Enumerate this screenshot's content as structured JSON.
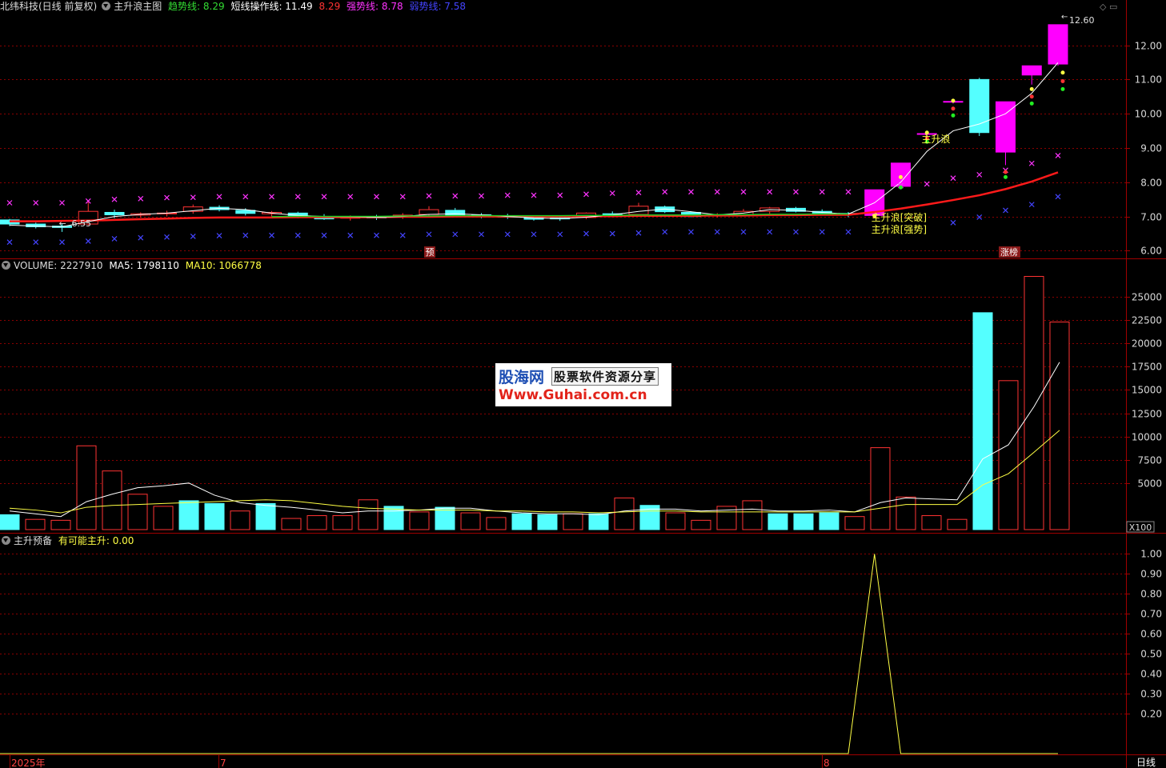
{
  "header": {
    "stock": "北纬科技(日线 前复权)",
    "indicator": "主升浪主图",
    "items": [
      {
        "label": "趋势线: 8.29",
        "color": "#33dd33"
      },
      {
        "label": "短线操作线: 11.49",
        "color": "#ffffff"
      },
      {
        "label": "8.29",
        "color": "#ff3333"
      },
      {
        "label": "强势线: 8.78",
        "color": "#ff33ff"
      },
      {
        "label": "弱势线: 7.58",
        "color": "#4444ff"
      }
    ]
  },
  "volume_header": {
    "volume": "VOLUME: 2227910",
    "ma5": "MA5: 1798110",
    "ma10": "MA10: 1066778"
  },
  "sub_header": {
    "name": "主升预备",
    "value": "有可能主升: 0.00"
  },
  "watermark": {
    "line1": "股海网",
    "line1b": "股票软件资源分享",
    "line2": "Www.Guhai.com.cn"
  },
  "labels": {
    "high": "12.60",
    "low": "6.55",
    "arrow_left": "←",
    "arrow_high": "←",
    "wave": "主升浪",
    "break": "主升浪[突破]",
    "strong": "主升浪[强势]",
    "pre": "预",
    "limitup": "涨榜",
    "unit": "X100",
    "period": "日线"
  },
  "x_axis": [
    "2025年",
    "7",
    "8"
  ],
  "colors": {
    "up": "#ff3333",
    "down": "#54ffff",
    "limit": "#ff00ff",
    "grid": "#8b0000",
    "trend": "#ff1a1a",
    "short": "#ffffff"
  },
  "chart_data": [
    {
      "type": "candlestick",
      "title": "主升浪主图",
      "ylim": [
        5.8,
        12.9
      ],
      "yticks": [
        6.0,
        7.0,
        8.0,
        9.0,
        10.0,
        11.0,
        12.0
      ],
      "ohlc": [
        [
          6.9,
          6.93,
          6.72,
          6.78
        ],
        [
          6.78,
          6.82,
          6.65,
          6.7
        ],
        [
          6.72,
          6.78,
          6.55,
          6.68
        ],
        [
          6.78,
          7.45,
          6.74,
          7.15
        ],
        [
          7.12,
          7.2,
          6.95,
          7.05
        ],
        [
          7.04,
          7.12,
          6.97,
          7.08
        ],
        [
          7.08,
          7.17,
          7.0,
          7.1
        ],
        [
          7.15,
          7.35,
          7.08,
          7.28
        ],
        [
          7.27,
          7.33,
          7.15,
          7.2
        ],
        [
          7.18,
          7.24,
          7.03,
          7.09
        ],
        [
          7.08,
          7.16,
          7.0,
          7.12
        ],
        [
          7.1,
          7.14,
          6.95,
          7.0
        ],
        [
          7.0,
          7.07,
          6.9,
          6.93
        ],
        [
          6.95,
          7.03,
          6.88,
          7.0
        ],
        [
          6.98,
          7.05,
          6.9,
          6.97
        ],
        [
          7.0,
          7.1,
          6.93,
          7.04
        ],
        [
          7.06,
          7.3,
          7.0,
          7.2
        ],
        [
          7.18,
          7.25,
          7.0,
          7.05
        ],
        [
          7.05,
          7.1,
          6.95,
          7.02
        ],
        [
          7.02,
          7.08,
          6.93,
          6.98
        ],
        [
          6.98,
          7.02,
          6.88,
          6.92
        ],
        [
          6.96,
          7.02,
          6.87,
          6.93
        ],
        [
          6.97,
          7.12,
          6.92,
          7.1
        ],
        [
          7.08,
          7.15,
          7.0,
          7.06
        ],
        [
          7.06,
          7.4,
          7.04,
          7.3
        ],
        [
          7.28,
          7.32,
          7.1,
          7.14
        ],
        [
          7.12,
          7.15,
          6.98,
          7.0
        ],
        [
          7.02,
          7.1,
          6.97,
          7.05
        ],
        [
          7.05,
          7.22,
          7.0,
          7.15
        ],
        [
          7.15,
          7.28,
          7.05,
          7.25
        ],
        [
          7.24,
          7.28,
          7.12,
          7.15
        ],
        [
          7.15,
          7.21,
          7.05,
          7.1
        ],
        [
          7.09,
          7.13,
          6.98,
          7.06
        ],
        [
          7.03,
          7.78,
          7.0,
          7.78
        ],
        [
          7.88,
          8.56,
          7.85,
          8.56
        ],
        [
          9.42,
          9.42,
          9.25,
          9.42
        ],
        [
          10.36,
          10.36,
          10.3,
          10.36
        ],
        [
          11.0,
          11.05,
          9.35,
          9.45
        ],
        [
          8.88,
          10.35,
          8.5,
          10.35
        ],
        [
          11.13,
          11.4,
          10.85,
          11.4
        ],
        [
          11.45,
          12.6,
          11.4,
          12.6
        ]
      ],
      "limit_up": [
        false,
        false,
        false,
        false,
        false,
        false,
        false,
        false,
        false,
        false,
        false,
        false,
        false,
        false,
        false,
        false,
        false,
        false,
        false,
        false,
        false,
        false,
        false,
        false,
        false,
        false,
        false,
        false,
        false,
        false,
        false,
        false,
        false,
        true,
        true,
        true,
        true,
        false,
        true,
        true,
        true
      ],
      "series": [
        {
          "name": "趋势线",
          "color": "#ff1a1a",
          "values": [
            6.86,
            6.86,
            6.87,
            6.88,
            6.9,
            6.92,
            6.94,
            6.96,
            6.97,
            6.97,
            6.97,
            6.98,
            6.98,
            6.98,
            6.98,
            6.99,
            6.99,
            7.0,
            7.0,
            7.0,
            7.0,
            7.0,
            7.01,
            7.01,
            7.02,
            7.02,
            7.02,
            7.03,
            7.03,
            7.04,
            7.04,
            7.05,
            7.05,
            7.13,
            7.23,
            7.35,
            7.48,
            7.62,
            7.8,
            8.02,
            8.29
          ]
        },
        {
          "name": "短线操作线",
          "color": "#ffffff",
          "values": [
            6.75,
            6.72,
            6.7,
            6.85,
            7.0,
            7.06,
            7.1,
            7.17,
            7.24,
            7.2,
            7.1,
            7.03,
            7.0,
            6.99,
            6.98,
            7.0,
            7.06,
            7.08,
            7.05,
            7.0,
            6.96,
            6.94,
            6.98,
            7.05,
            7.15,
            7.22,
            7.14,
            7.05,
            7.1,
            7.2,
            7.18,
            7.12,
            7.07,
            7.4,
            8.0,
            8.9,
            9.5,
            9.7,
            10.0,
            10.6,
            11.49
          ]
        }
      ],
      "markers_x": {
        "top": {
          "color": "#ff33ff",
          "values": [
            7.4,
            7.4,
            7.4,
            7.45,
            7.5,
            7.52,
            7.55,
            7.56,
            7.58,
            7.58,
            7.58,
            7.58,
            7.58,
            7.58,
            7.58,
            7.58,
            7.6,
            7.6,
            7.6,
            7.62,
            7.62,
            7.62,
            7.65,
            7.68,
            7.7,
            7.72,
            7.72,
            7.72,
            7.72,
            7.72,
            7.72,
            7.72,
            7.72,
            null,
            7.9,
            7.95,
            8.12,
            8.22,
            8.35,
            8.55,
            8.78
          ]
        },
        "bottom": {
          "color": "#4444ff",
          "values": [
            6.25,
            6.25,
            6.25,
            6.28,
            6.35,
            6.38,
            6.4,
            6.42,
            6.44,
            6.45,
            6.45,
            6.45,
            6.45,
            6.45,
            6.45,
            6.45,
            6.48,
            6.48,
            6.48,
            6.48,
            6.48,
            6.48,
            6.5,
            6.5,
            6.52,
            6.55,
            6.55,
            6.55,
            6.55,
            6.55,
            6.55,
            6.55,
            6.55,
            null,
            null,
            null,
            6.82,
            6.98,
            7.18,
            7.35,
            7.58
          ]
        }
      }
    },
    {
      "type": "bar",
      "title": "VOLUME",
      "ylim": [
        0,
        27500
      ],
      "yticks": [
        5000,
        7500,
        10000,
        12500,
        15000,
        17500,
        20000,
        22500,
        25000
      ],
      "values": [
        1600,
        1100,
        1000,
        9000,
        6300,
        3800,
        2500,
        3100,
        2800,
        2000,
        2800,
        1200,
        1500,
        1500,
        3200,
        2500,
        1900,
        2400,
        1800,
        1300,
        1700,
        1600,
        1700,
        1700,
        3400,
        2600,
        1800,
        1000,
        2500,
        3100,
        1700,
        1700,
        1800,
        1400,
        8800,
        3500,
        1500,
        1100,
        23300,
        16000,
        27200,
        22300
      ],
      "up": [
        false,
        true,
        true,
        true,
        true,
        true,
        true,
        false,
        false,
        true,
        false,
        true,
        true,
        true,
        true,
        false,
        true,
        false,
        true,
        true,
        false,
        false,
        true,
        false,
        true,
        false,
        true,
        true,
        true,
        true,
        false,
        false,
        false,
        true,
        true,
        true,
        true,
        true,
        false,
        true,
        true,
        true
      ],
      "series": [
        {
          "name": "MA5",
          "color": "#ffffff",
          "values": [
            2000,
            1700,
            1400,
            3000,
            3800,
            4500,
            4700,
            5000,
            3700,
            2900,
            2600,
            2400,
            2100,
            1800,
            2000,
            2000,
            2100,
            2300,
            2300,
            2000,
            1800,
            1700,
            1700,
            1600,
            2000,
            2200,
            2200,
            2000,
            2100,
            2200,
            2000,
            2000,
            2100,
            1900,
            2900,
            3400,
            3300,
            3200,
            7600,
            9100,
            13200,
            17980
          ]
        },
        {
          "name": "MA10",
          "color": "#ffff44",
          "values": [
            2300,
            2100,
            1800,
            2400,
            2600,
            2700,
            2800,
            2900,
            3000,
            3100,
            3200,
            3100,
            2800,
            2500,
            2300,
            2200,
            2100,
            2100,
            2100,
            2000,
            2000,
            1900,
            1900,
            1800,
            1900,
            2000,
            2000,
            1900,
            1900,
            1900,
            1900,
            1900,
            1900,
            1900,
            2300,
            2700,
            2700,
            2700,
            4800,
            6000,
            8300,
            10668
          ]
        }
      ]
    },
    {
      "type": "line",
      "title": "主升预备",
      "ylim": [
        0,
        1.05
      ],
      "yticks": [
        0.2,
        0.3,
        0.4,
        0.5,
        0.6,
        0.7,
        0.8,
        0.9,
        1.0
      ],
      "series": [
        {
          "name": "有可能主升",
          "color": "#ffff44",
          "values": [
            0,
            0,
            0,
            0,
            0,
            0,
            0,
            0,
            0,
            0,
            0,
            0,
            0,
            0,
            0,
            0,
            0,
            0,
            0,
            0,
            0,
            0,
            0,
            0,
            0,
            0,
            0,
            0,
            0,
            0,
            0,
            0,
            0,
            1,
            0,
            0,
            0,
            0,
            0,
            0,
            0
          ]
        }
      ]
    }
  ]
}
